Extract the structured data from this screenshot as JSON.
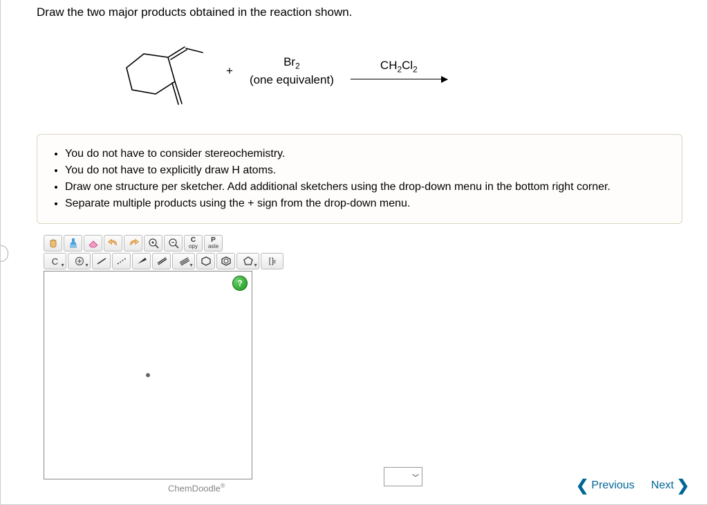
{
  "question": "Draw the two major products obtained in the reaction shown.",
  "reaction": {
    "plus": "+",
    "reagent": "Br",
    "reagent_sub": "2",
    "reagent_note": "(one equivalent)",
    "solvent_pre": "CH",
    "solvent_sub1": "2",
    "solvent_mid": "Cl",
    "solvent_sub2": "2"
  },
  "instructions": [
    "You do not have to consider stereochemistry.",
    "You do not have to explicitly draw H atoms.",
    "Draw one structure per sketcher. Add additional sketchers using the drop-down menu in the bottom right corner.",
    "Separate multiple products using the + sign from the drop-down menu."
  ],
  "toolbar": {
    "copy_top": "C",
    "copy_bottom": "opy",
    "paste_top": "P",
    "paste_bottom": "aste",
    "atom_label": "C"
  },
  "sketcher": {
    "help": "?",
    "brand": "ChemDoodle",
    "brand_sup": "®"
  },
  "nav": {
    "previous": "Previous",
    "next": "Next"
  }
}
